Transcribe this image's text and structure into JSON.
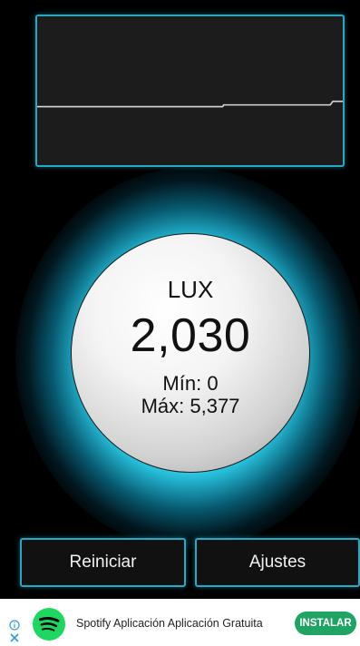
{
  "meter": {
    "unit_label": "LUX",
    "current_value": "2,030",
    "min_text": "Mín: 0",
    "max_text": "Máx: 5,377"
  },
  "graph": {
    "description_icon": "lux-history-graph",
    "line_color": "#d8d8d8",
    "readings_lux": [
      2030,
      2030,
      2040,
      2040,
      2055
    ]
  },
  "buttons": {
    "reset_label": "Reiniciar",
    "settings_label": "Ajustes"
  },
  "ad": {
    "text": "Spotify Aplicación Aplicación Gratuita",
    "install_label": "INSTALAR",
    "info_icon": "info-icon",
    "close_icon": "close-icon",
    "logo_icon": "spotify-logo-icon"
  },
  "colors": {
    "accent": "#27a9c4",
    "glow": "#40d8f0",
    "install_green": "#1fa463",
    "spotify_green": "#1ed760"
  }
}
